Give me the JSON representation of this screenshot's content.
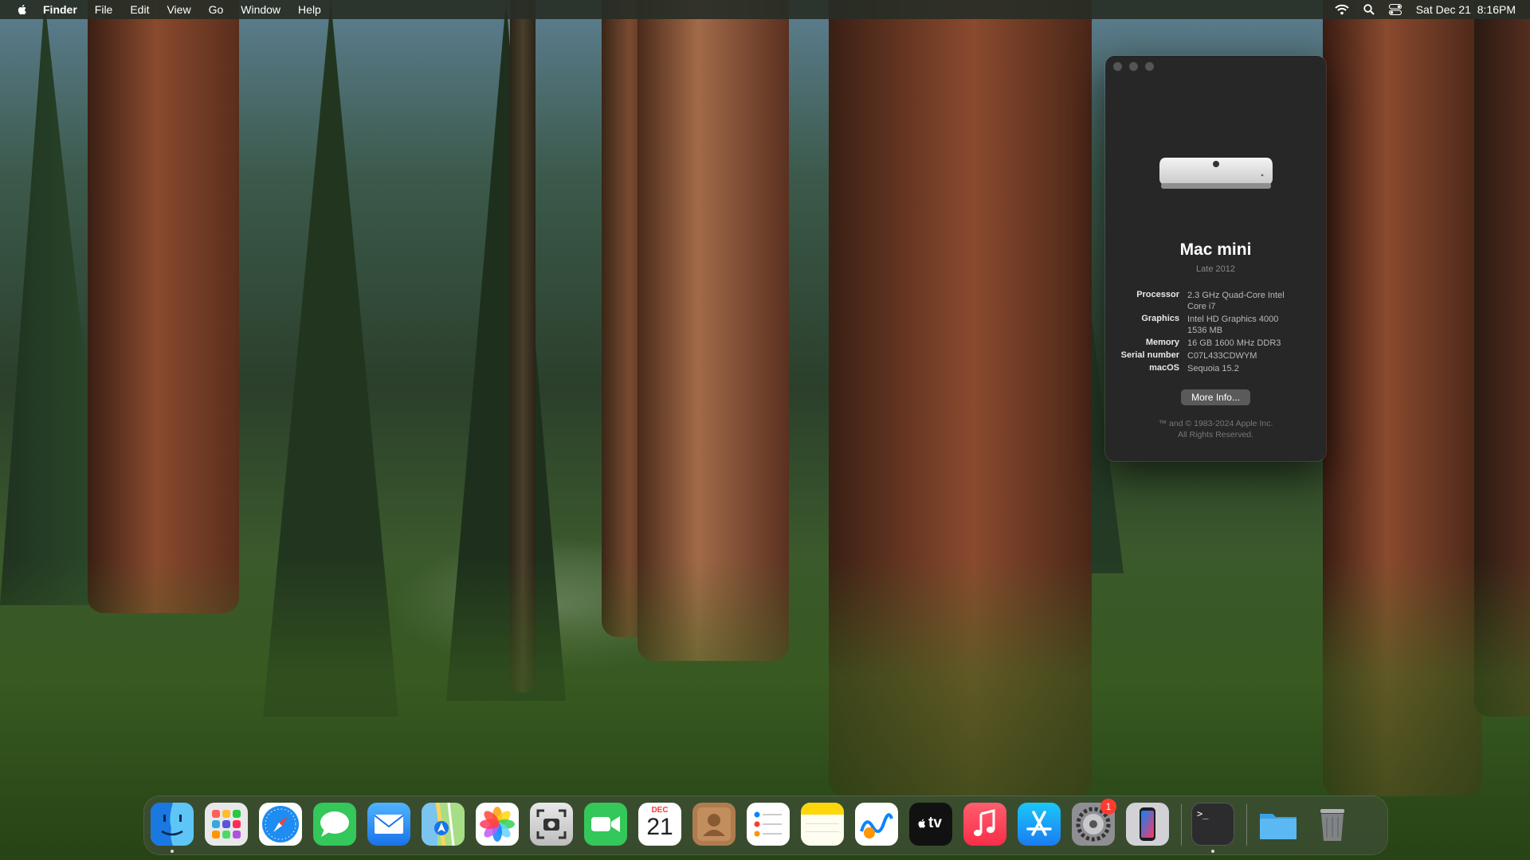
{
  "menubar": {
    "app_name": "Finder",
    "menus": [
      "File",
      "Edit",
      "View",
      "Go",
      "Window",
      "Help"
    ],
    "clock": "Sat Dec 21  8:16PM",
    "status_icons": [
      "wifi-icon",
      "spotlight-search-icon",
      "control-center-icon"
    ]
  },
  "about_window": {
    "model": "Mac mini",
    "year": "Late 2012",
    "specs": [
      {
        "label": "Processor",
        "value": "2.3 GHz Quad-Core Intel Core i7"
      },
      {
        "label": "Graphics",
        "value": "Intel HD Graphics 4000 1536 MB"
      },
      {
        "label": "Memory",
        "value": "16 GB 1600 MHz DDR3"
      },
      {
        "label": "Serial number",
        "value": "C07L433CDWYM"
      },
      {
        "label": "macOS",
        "value": "Sequoia 15.2"
      }
    ],
    "more_info_label": "More Info...",
    "copyright_line1": "™ and © 1983-2024 Apple Inc.",
    "copyright_line2": "All Rights Reserved."
  },
  "dock": {
    "apps": [
      {
        "name": "finder-icon",
        "running": true
      },
      {
        "name": "launchpad-icon"
      },
      {
        "name": "safari-icon"
      },
      {
        "name": "messages-icon"
      },
      {
        "name": "mail-icon"
      },
      {
        "name": "maps-icon"
      },
      {
        "name": "photos-icon"
      },
      {
        "name": "screenshot-icon"
      },
      {
        "name": "facetime-icon"
      },
      {
        "name": "calendar-icon",
        "month": "DEC",
        "day": "21"
      },
      {
        "name": "contacts-icon"
      },
      {
        "name": "reminders-icon"
      },
      {
        "name": "notes-icon"
      },
      {
        "name": "freeform-icon"
      },
      {
        "name": "apple-tv-icon",
        "label": "tv"
      },
      {
        "name": "music-icon"
      },
      {
        "name": "app-store-icon"
      },
      {
        "name": "system-settings-icon",
        "badge": "1"
      },
      {
        "name": "iphone-mirroring-icon"
      },
      {
        "name": "terminal-icon",
        "running": true,
        "label": ">_"
      },
      {
        "name": "downloads-folder-icon"
      },
      {
        "name": "trash-icon"
      }
    ]
  }
}
